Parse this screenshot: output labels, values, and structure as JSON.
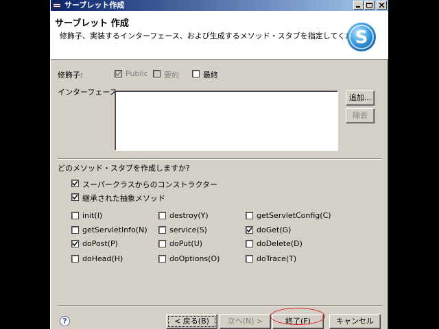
{
  "window": {
    "title": "サーブレット作成",
    "min_icon": "minimize-icon",
    "max_icon": "maximize-icon",
    "close_icon": "close-icon"
  },
  "header": {
    "title": "サーブレット 作成",
    "description": "修飾子、実装するインターフェース、および生成するメソッド・スタブを指定してください。",
    "logo_icon": "servlet-logo-icon"
  },
  "modifiers": {
    "label": "修飾子:",
    "public": {
      "label": "Public",
      "checked": true,
      "enabled": false
    },
    "abstract": {
      "label": "要約",
      "checked": false,
      "enabled": false
    },
    "final": {
      "label": "最終",
      "checked": false,
      "enabled": true
    }
  },
  "interfaces": {
    "label": "インターフェース:",
    "add_label": "追加...",
    "remove_label": "除去",
    "items": []
  },
  "stubs": {
    "question": "どのメソッド・スタブを作成しますか?",
    "constructors": {
      "label": "スーパークラスからのコンストラクター",
      "checked": true
    },
    "inherited": {
      "label": "継承された抽象メソッド",
      "checked": true
    },
    "methods": [
      {
        "label": "init(I)",
        "checked": false
      },
      {
        "label": "destroy(Y)",
        "checked": false
      },
      {
        "label": "getServletConfig(C)",
        "checked": false
      },
      {
        "label": "getServletInfo(N)",
        "checked": false
      },
      {
        "label": "service(S)",
        "checked": false
      },
      {
        "label": "doGet(G)",
        "checked": true
      },
      {
        "label": "doPost(P)",
        "checked": true
      },
      {
        "label": "doPut(U)",
        "checked": false
      },
      {
        "label": "doDelete(D)",
        "checked": false
      },
      {
        "label": "doHead(H)",
        "checked": false
      },
      {
        "label": "doOptions(O)",
        "checked": false
      },
      {
        "label": "doTrace(T)",
        "checked": false
      }
    ]
  },
  "footer": {
    "help_icon": "help-icon",
    "back_label": "< 戻る(B)",
    "next_label": "次へ(N) >",
    "finish_label": "終了(F)",
    "cancel_label": "キャンセル",
    "highlight_color": "#e02020"
  }
}
